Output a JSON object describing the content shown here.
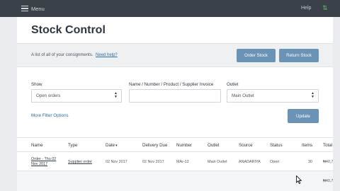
{
  "topbar": {
    "menu_label": "Menu",
    "help_label": "Help",
    "status_icon_glyph": "⇅"
  },
  "page": {
    "title": "Stock Control"
  },
  "banner": {
    "description": "A list of all of your consignments.",
    "help_link": "Need help?",
    "order_stock_label": "Order Stock",
    "return_stock_label": "Return Stock"
  },
  "filters": {
    "show_label": "Show",
    "show_value": "Open orders",
    "name_label": "Name / Number / Product / Supplier Invoice",
    "name_value": "",
    "outlet_label": "Outlet",
    "outlet_value": "Main Outlet",
    "more_label": "More Filter Options",
    "update_label": "Update"
  },
  "table": {
    "columns": [
      "Name",
      "Type",
      "Date",
      "Delivery Due",
      "Number",
      "Outlet",
      "Source",
      "Status",
      "Items",
      "Total"
    ],
    "sorted_caret": "▾",
    "row": {
      "name_line1": "Order - Thu 02",
      "name_line2": "Nov 2017",
      "type": "Supplier order",
      "date": "02 Nov 2017",
      "delivery_due": "02 Nov 2017",
      "number": "MAr-12",
      "outlet": "Main Outlet",
      "source": "ANADARIYA",
      "status": "Open",
      "items": "30",
      "total": "₦40,7"
    },
    "footer_total": "₦40,7"
  },
  "colors": {
    "topbar": "#3a4148",
    "accent_button": "#6b93b6",
    "link": "#2f6e9f",
    "status_icon": "#63c06b"
  }
}
